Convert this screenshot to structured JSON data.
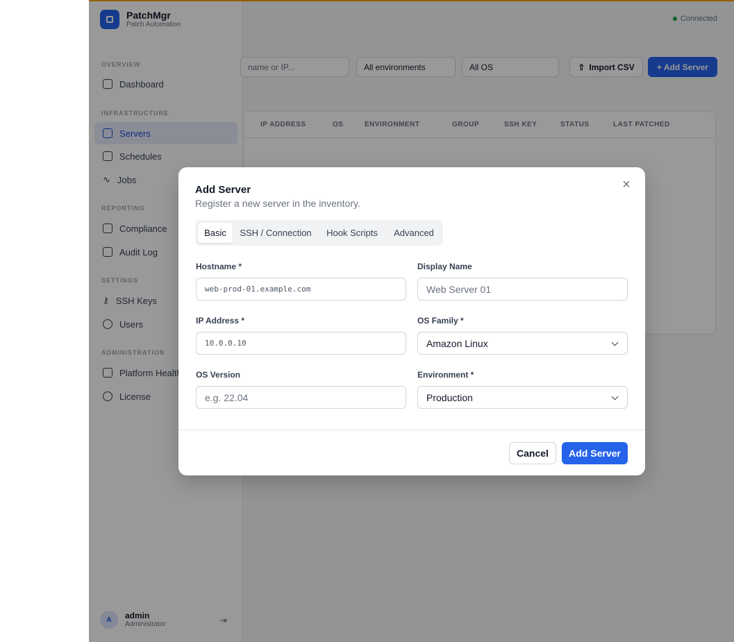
{
  "app": {
    "brand_name": "PatchMgr",
    "brand_sub": "Patch Automation",
    "connection_status": "Connected",
    "accent_color": "#f59e0b",
    "primary_color": "#2563eb"
  },
  "sidebar": {
    "sections": {
      "overview": "OVERVIEW",
      "infrastructure": "INFRASTRUCTURE",
      "reporting": "REPORTING",
      "settings": "SETTINGS",
      "administration": "ADMINISTRATION"
    },
    "items": {
      "dashboard": "Dashboard",
      "servers": "Servers",
      "schedules": "Schedules",
      "jobs": "Jobs",
      "compliance": "Compliance",
      "audit_log": "Audit Log",
      "ssh_keys": "SSH Keys",
      "users": "Users",
      "platform_health": "Platform Health",
      "license": "License"
    },
    "active_item": "Servers",
    "user": {
      "initial": "A",
      "name": "admin",
      "role": "Administrator"
    }
  },
  "toolbar": {
    "search_placeholder": "name or IP...",
    "environment_filter": "All environments",
    "os_filter": "All OS",
    "import_label": "Import CSV",
    "add_label": "+ Add Server"
  },
  "table": {
    "columns": [
      "IP ADDRESS",
      "OS",
      "ENVIRONMENT",
      "GROUP",
      "SSH KEY",
      "STATUS",
      "LAST PATCHED"
    ]
  },
  "modal": {
    "title": "Add Server",
    "subtitle": "Register a new server in the inventory.",
    "tabs": [
      "Basic",
      "SSH / Connection",
      "Hook Scripts",
      "Advanced"
    ],
    "active_tab": "Basic",
    "fields": {
      "hostname": {
        "label": "Hostname *",
        "placeholder": "web-prod-01.example.com"
      },
      "display_name": {
        "label": "Display Name",
        "placeholder": "Web Server 01"
      },
      "ip_address": {
        "label": "IP Address *",
        "placeholder": "10.0.0.10"
      },
      "os_family": {
        "label": "OS Family *",
        "value": "Amazon Linux"
      },
      "os_version": {
        "label": "OS Version",
        "placeholder": "e.g. 22.04"
      },
      "environment": {
        "label": "Environment *",
        "value": "Production"
      }
    },
    "cancel_label": "Cancel",
    "submit_label": "Add Server",
    "close_glyph": "×"
  }
}
